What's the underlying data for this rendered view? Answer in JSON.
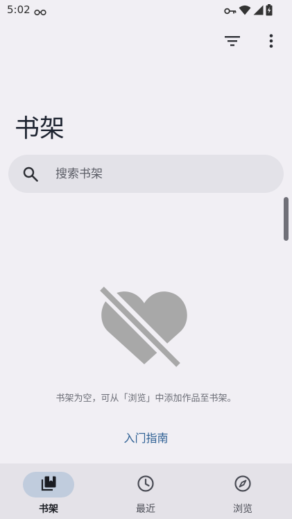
{
  "status_bar": {
    "time": "5:02",
    "icons": [
      "glasses-icon",
      "key-icon",
      "wifi-icon",
      "signal-icon",
      "battery-charging-icon"
    ]
  },
  "toolbar": {
    "filter_icon": "filter-icon",
    "more_icon": "more-vert-icon"
  },
  "page": {
    "title": "书架"
  },
  "search": {
    "placeholder": "搜索书架",
    "icon": "search-icon"
  },
  "empty_state": {
    "icon": "heart-off-icon",
    "message": "书架为空，可从「浏览」中添加作品至书架。",
    "guide_link": "入门指南"
  },
  "bottom_nav": {
    "items": [
      {
        "label": "书架",
        "icon": "library-icon",
        "active": true
      },
      {
        "label": "最近",
        "icon": "history-icon",
        "active": false
      },
      {
        "label": "浏览",
        "icon": "explore-icon",
        "active": false
      }
    ]
  },
  "colors": {
    "background": "#f1eff4",
    "search_bg": "#e3e2e8",
    "accent_link": "#2d5f93",
    "nav_active_pill": "#c0ccdd",
    "empty_icon": "#a8a8a8"
  }
}
